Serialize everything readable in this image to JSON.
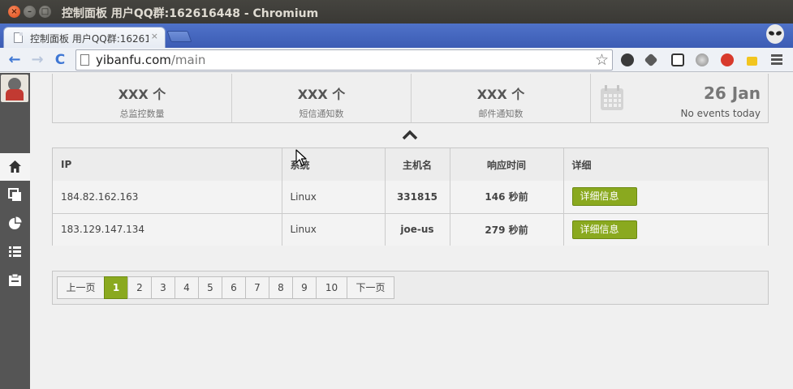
{
  "window": {
    "title": "控制面板 用户QQ群:162616448 - Chromium",
    "close_glyph": "×",
    "minimize_glyph": "–",
    "maximize_glyph": "□"
  },
  "browser": {
    "tab_title": "控制面板 用户QQ群:16261",
    "tab_close_glyph": "×",
    "url_host": "yibanfu.com",
    "url_path": "/main",
    "back_glyph": "←",
    "forward_glyph": "→",
    "reload_glyph": "C",
    "star_glyph": "☆"
  },
  "colors": {
    "accent_green": "#8aa91f",
    "sidebar_bg": "#555555",
    "tab_strip_blue": "#4f72c9",
    "title_bar": "#3a3935"
  },
  "sidebar": {
    "items": [
      {
        "icon": "home-icon",
        "active": true
      },
      {
        "icon": "copy-icon",
        "active": false
      },
      {
        "icon": "pie-chart-icon",
        "active": false
      },
      {
        "icon": "list-icon",
        "active": false
      },
      {
        "icon": "clipboard-icon",
        "active": false
      }
    ]
  },
  "stats": [
    {
      "value": "XXX 个",
      "label": "总监控数量"
    },
    {
      "value": "XXX 个",
      "label": "短信通知数"
    },
    {
      "value": "XXX 个",
      "label": "邮件通知数"
    }
  ],
  "calendar": {
    "date": "26 Jan",
    "events": "No events today"
  },
  "table": {
    "headers": [
      "IP",
      "系统",
      "主机名",
      "响应时间",
      "详细"
    ],
    "rows": [
      {
        "ip": "184.82.162.163",
        "system": "Linux",
        "host": "331815",
        "response": "146 秒前",
        "detail": "详细信息"
      },
      {
        "ip": "183.129.147.134",
        "system": "Linux",
        "host": "joe-us",
        "response": "279 秒前",
        "detail": "详细信息"
      }
    ]
  },
  "pagination": {
    "prev": "上一页",
    "pages": [
      "1",
      "2",
      "3",
      "4",
      "5",
      "6",
      "7",
      "8",
      "9",
      "10"
    ],
    "current": "1",
    "next": "下一页"
  }
}
